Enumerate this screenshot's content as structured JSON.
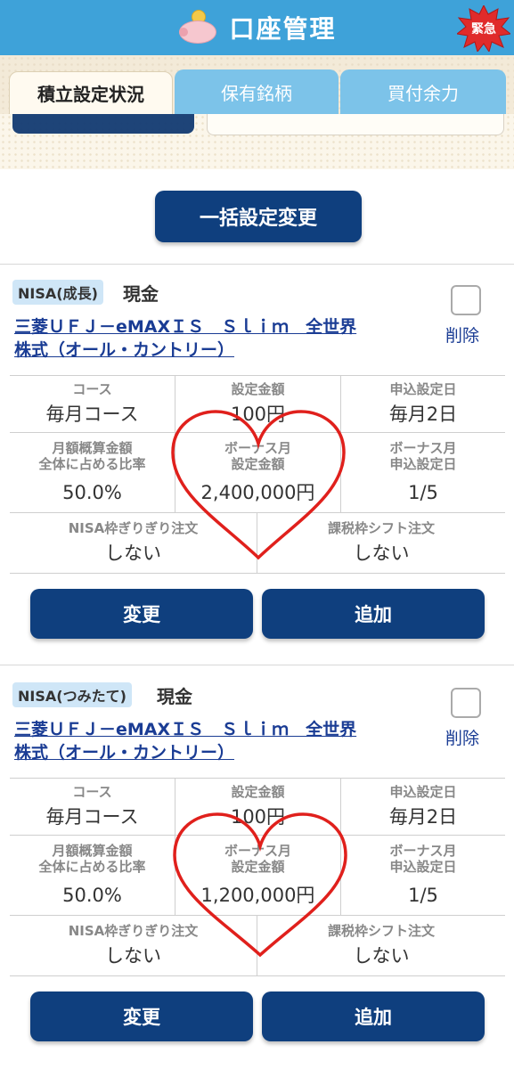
{
  "header": {
    "title": "口座管理",
    "emergency_label": "緊急",
    "color": "#3ea2d9"
  },
  "tabs": [
    {
      "label": "積立設定状況",
      "active": true
    },
    {
      "label": "保有銘柄",
      "active": false
    },
    {
      "label": "買付余力",
      "active": false
    }
  ],
  "bulk_change_label": "一括設定変更",
  "cards": [
    {
      "account_badge": "NISA(成長)",
      "payment_type": "現金",
      "fund_name_line1": "三菱ＵＦＪ－eMAXＩＳ　Ｓｌｉｍ　全世界",
      "fund_name_line2": "株式（オール・カントリー）",
      "delete_label": "削除",
      "course_label": "コース",
      "course_value": "毎月コース",
      "amount_label": "設定金額",
      "amount_value": "100円",
      "apply_day_label": "申込設定日",
      "apply_day_value": "毎月2日",
      "ratio_label_1": "月額概算金額",
      "ratio_label_2": "全体に占める比率",
      "ratio_value": "50.0%",
      "bonus_amount_label_1": "ボーナス月",
      "bonus_amount_label_2": "設定金額",
      "bonus_amount_value": "2,400,000円",
      "bonus_day_label_1": "ボーナス月",
      "bonus_day_label_2": "申込設定日",
      "bonus_day_value": "1/5",
      "nisa_limit_label": "NISA枠ぎりぎり注文",
      "nisa_limit_value": "しない",
      "tax_shift_label": "課税枠シフト注文",
      "tax_shift_value": "しない",
      "change_label": "変更",
      "add_label": "追加"
    },
    {
      "account_badge": "NISA(つみたて)",
      "payment_type": "現金",
      "fund_name_line1": "三菱ＵＦＪ－eMAXＩＳ　Ｓｌｉｍ　全世界",
      "fund_name_line2": "株式（オール・カントリー）",
      "delete_label": "削除",
      "course_label": "コース",
      "course_value": "毎月コース",
      "amount_label": "設定金額",
      "amount_value": "100円",
      "apply_day_label": "申込設定日",
      "apply_day_value": "毎月2日",
      "ratio_label_1": "月額概算金額",
      "ratio_label_2": "全体に占める比率",
      "ratio_value": "50.0%",
      "bonus_amount_label_1": "ボーナス月",
      "bonus_amount_label_2": "設定金額",
      "bonus_amount_value": "1,200,000円",
      "bonus_day_label_1": "ボーナス月",
      "bonus_day_label_2": "申込設定日",
      "bonus_day_value": "1/5",
      "nisa_limit_label": "NISA枠ぎりぎり注文",
      "nisa_limit_value": "しない",
      "tax_shift_label": "課税枠シフト注文",
      "tax_shift_value": "しない",
      "change_label": "変更",
      "add_label": "追加"
    }
  ],
  "accent_colors": {
    "button": "#0f3f7e",
    "link": "#1a3c94",
    "heart": "#e0201c"
  }
}
